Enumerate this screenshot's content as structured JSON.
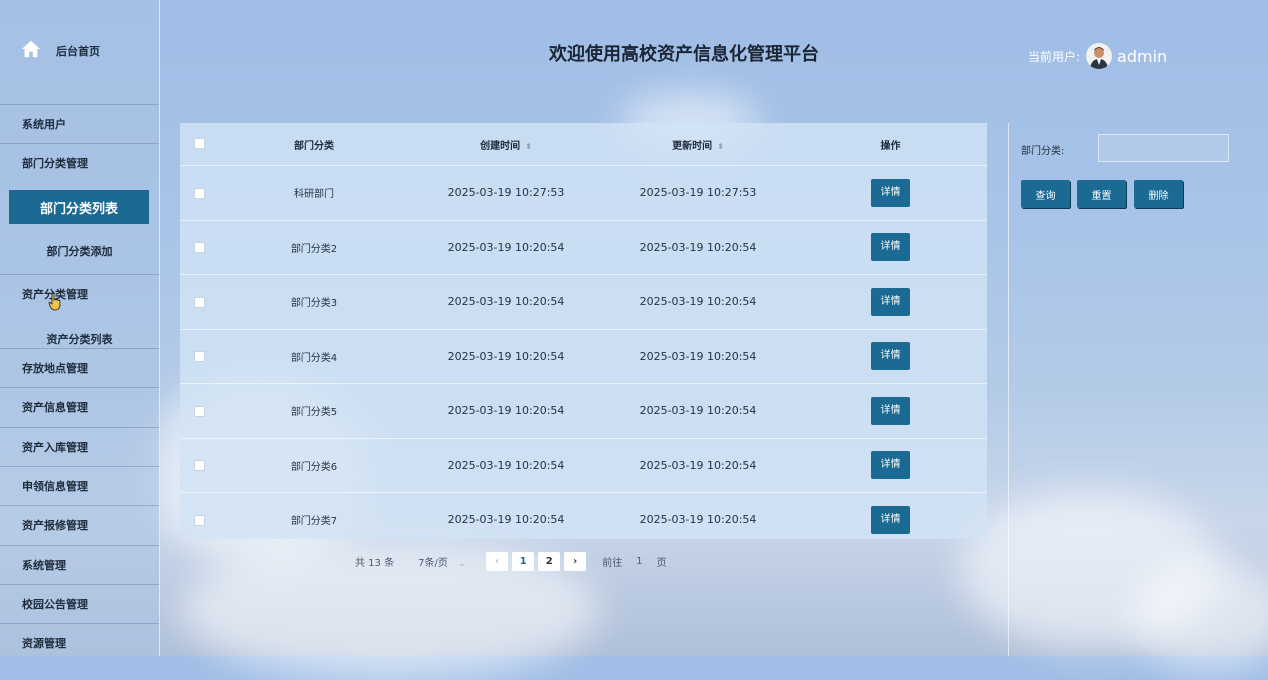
{
  "header": {
    "title": "欢迎使用高校资产信息化管理平台",
    "user_label": "当前用户:",
    "username": "admin"
  },
  "sidebar": {
    "home": "后台首页",
    "items": [
      "系统用户",
      "部门分类管理",
      "资产分类管理",
      "存放地点管理",
      "资产信息管理",
      "资产入库管理",
      "申领信息管理",
      "资产报修管理",
      "系统管理",
      "校园公告管理",
      "资源管理"
    ],
    "sub_active": "部门分类列表",
    "sub_add": "部门分类添加",
    "sub_asset_list": "资产分类列表"
  },
  "table": {
    "headers": {
      "name": "部门分类",
      "created": "创建时间",
      "updated": "更新时间",
      "action": "操作"
    },
    "detail_label": "详情",
    "rows": [
      {
        "name": "科研部门",
        "created": "2025-03-19 10:27:53",
        "updated": "2025-03-19 10:27:53"
      },
      {
        "name": "部门分类2",
        "created": "2025-03-19 10:20:54",
        "updated": "2025-03-19 10:20:54"
      },
      {
        "name": "部门分类3",
        "created": "2025-03-19 10:20:54",
        "updated": "2025-03-19 10:20:54"
      },
      {
        "name": "部门分类4",
        "created": "2025-03-19 10:20:54",
        "updated": "2025-03-19 10:20:54"
      },
      {
        "name": "部门分类5",
        "created": "2025-03-19 10:20:54",
        "updated": "2025-03-19 10:20:54"
      },
      {
        "name": "部门分类6",
        "created": "2025-03-19 10:20:54",
        "updated": "2025-03-19 10:20:54"
      },
      {
        "name": "部门分类7",
        "created": "2025-03-19 10:20:54",
        "updated": "2025-03-19 10:20:54"
      }
    ]
  },
  "pagination": {
    "total": "共 13 条",
    "page_size": "7条/页",
    "pages": [
      "1",
      "2"
    ],
    "current": "1",
    "goto_label": "前往",
    "goto_value": "1",
    "page_unit": "页"
  },
  "filter": {
    "label": "部门分类:",
    "value": "",
    "search": "查询",
    "reset": "重置",
    "delete": "删除"
  },
  "colors": {
    "primary": "#1a6a94"
  }
}
